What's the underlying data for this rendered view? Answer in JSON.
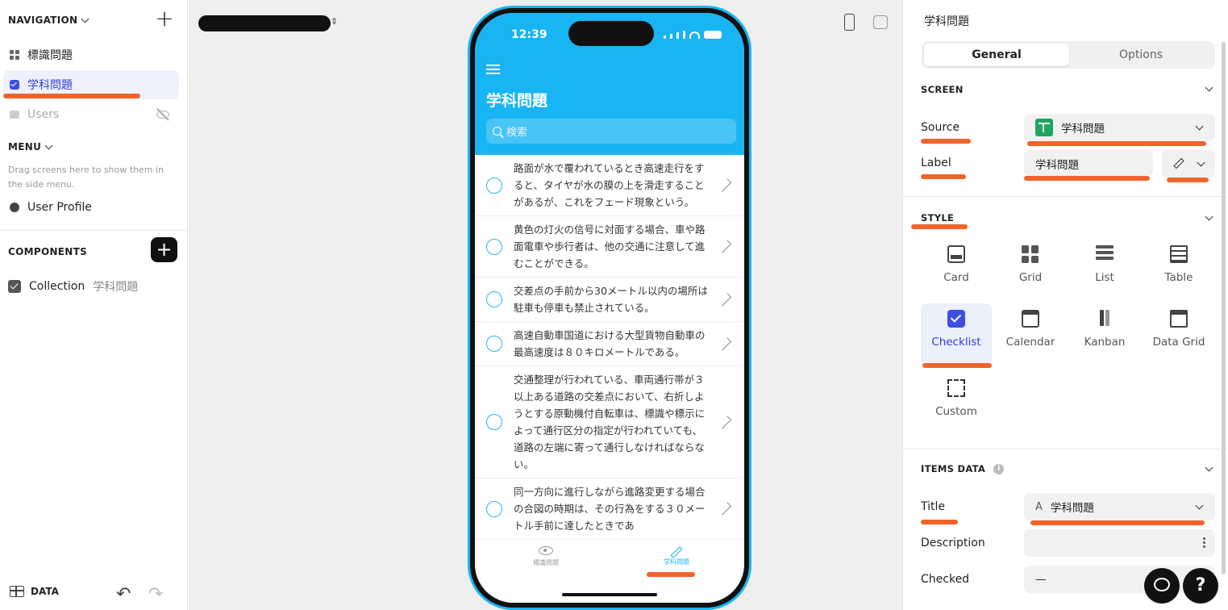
{
  "sidebar": {
    "navigation_label": "NAVIGATION",
    "nav_items": [
      {
        "label": "標識問題"
      },
      {
        "label": "学科問題"
      },
      {
        "label": "Users"
      }
    ],
    "menu_label": "MENU",
    "menu_hint": "Drag screens here to show them in the side menu.",
    "menu_items": [
      {
        "label": "User Profile"
      }
    ],
    "components_label": "COMPONENTS",
    "component": {
      "type": "Collection",
      "source": "学科問題"
    },
    "data_label": "DATA"
  },
  "phone": {
    "time": "12:39",
    "title": "学科問題",
    "search_placeholder": "検索",
    "items": [
      "路面が水で覆われているとき高速走行をすると、タイヤが水の膜の上を滑走することがあるが、これをフェード現象という。",
      "黄色の灯火の信号に対面する場合、車や路面電車や歩行者は、他の交通に注意して進むことができる。",
      "交差点の手前から30メートル以内の場所は駐車も停車も禁止されている。",
      "高速自動車国道における大型貨物自動車の最高速度は８０キロメートルである。",
      "交通整理が行われている、車両通行帯が３以上ある道路の交差点において、右折しようとする原動機付自転車は、標識や標示によって通行区分の指定が行われていても、道路の左端に寄って通行しなければならない。",
      "同一方向に進行しながら進路変更する場合の合図の時期は、その行為をする３０メートル手前に達したときであ"
    ],
    "tabs": [
      {
        "label": "標識問題"
      },
      {
        "label": "学科問題"
      }
    ]
  },
  "panel": {
    "title": "学科問題",
    "tabs": {
      "general": "General",
      "options": "Options"
    },
    "screen_section": "SCREEN",
    "source_label": "Source",
    "source_value": "学科問題",
    "label_label": "Label",
    "label_value": "学科問題",
    "style_section": "STYLE",
    "styles": [
      {
        "label": "Card"
      },
      {
        "label": "Grid"
      },
      {
        "label": "List"
      },
      {
        "label": "Table"
      },
      {
        "label": "Checklist"
      },
      {
        "label": "Calendar"
      },
      {
        "label": "Kanban"
      },
      {
        "label": "Data Grid"
      },
      {
        "label": "Custom"
      }
    ],
    "selected_style": "Checklist",
    "items_section": "ITEMS DATA",
    "title_label": "Title",
    "title_value": "学科問題",
    "description_label": "Description",
    "checked_label": "Checked",
    "checked_value": "—",
    "help_glyph": "?",
    "info_glyph": "i"
  },
  "colors": {
    "accent": "#18b4f3",
    "selection": "#2e3fd6",
    "annotation": "#f0642a"
  }
}
